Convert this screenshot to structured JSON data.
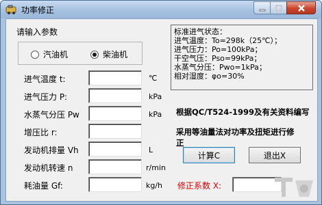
{
  "window": {
    "title": "功率修正"
  },
  "prompt": "请输入参数",
  "engine_type": {
    "options": [
      {
        "label": "汽油机",
        "selected": false
      },
      {
        "label": "柴油机",
        "selected": true
      }
    ]
  },
  "inputs": [
    {
      "label": "进气温度 t:",
      "unit": "℃",
      "value": ""
    },
    {
      "label": "进气压力 P:",
      "unit": "kPa",
      "value": ""
    },
    {
      "label": "水蒸气分压 Pw",
      "unit": "kPa",
      "value": ""
    },
    {
      "label": "增压比 r:",
      "unit": "",
      "value": ""
    },
    {
      "label": "发动机排量 Vh",
      "unit": "L",
      "value": ""
    },
    {
      "label": "发动机转速 n",
      "unit": "r/min",
      "value": ""
    },
    {
      "label": "耗油量 Gf:",
      "unit": "kg/h",
      "value": ""
    }
  ],
  "info": {
    "lines": [
      "标准进气状态：",
      "进气温度：To=298k（25℃）；",
      "进气压力：Po=100kPa；",
      "干空气压：Pso=99kPa；",
      "水蒸气分压：Pwo=1kPa；",
      "相对湿度：φo=30%"
    ]
  },
  "notes": {
    "line1": "根据QC/T524-1999及有关资料编写",
    "line2a": "采用等油量法对功率及扭矩进行修",
    "line2b": "正"
  },
  "buttons": {
    "calc": "计算C",
    "exit": "退出X"
  },
  "correction": {
    "label": "修正系数 X:",
    "value": ""
  },
  "colors": {
    "correction_label": "#e00000",
    "close_button": "#c9452d"
  }
}
